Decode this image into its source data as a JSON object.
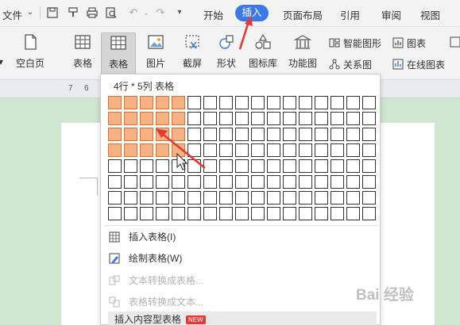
{
  "menubar": {
    "file_label": "文件",
    "tabs": [
      "开始",
      "插入",
      "页面布局",
      "引用",
      "审阅",
      "视图"
    ],
    "active_tab": "插入"
  },
  "ribbon": {
    "blank_page": "空白页",
    "table1": "表格",
    "table2": "表格",
    "picture": "图片",
    "screenshot": "截屏",
    "shape": "形状",
    "icon_lib": "图标库",
    "func_chart": "功能图",
    "smart_graphic": "智能图形",
    "chart": "图表",
    "relation_chart": "关系图",
    "online_chart": "在线图表"
  },
  "ruler": {
    "marks": [
      "7",
      "6"
    ]
  },
  "dropdown": {
    "title": "4行 * 5列 表格",
    "grid": {
      "rows": 8,
      "cols": 17,
      "selected_rows": 4,
      "selected_cols": 5
    },
    "items": [
      {
        "label": "插入表格(I)",
        "enabled": true
      },
      {
        "label": "绘制表格(W)",
        "enabled": true
      },
      {
        "label": "文本转换成表格...",
        "enabled": false
      },
      {
        "label": "表格转换成文本...",
        "enabled": false
      },
      {
        "label": "插入内容型表格",
        "enabled": true,
        "badge": "NEW"
      }
    ]
  },
  "watermark": "Bai 经验",
  "colors": {
    "accent": "#3d79e6",
    "selected_cell": "#f7b183",
    "annotation_red": "#e53935"
  }
}
